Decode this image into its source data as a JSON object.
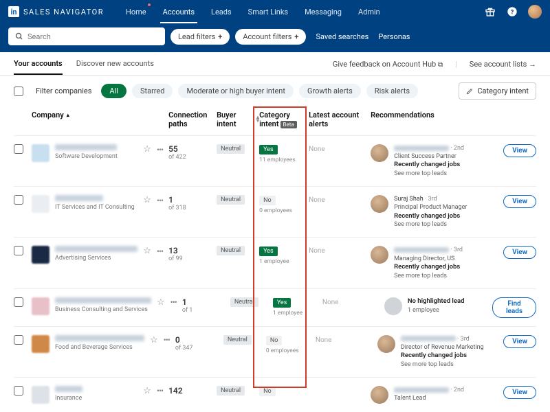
{
  "brand": "SALES NAVIGATOR",
  "nav": {
    "items": [
      "Home",
      "Accounts",
      "Leads",
      "Smart Links",
      "Messaging",
      "Admin"
    ],
    "active_index": 1
  },
  "search": {
    "placeholder": "Search",
    "lead_filters": "Lead filters",
    "account_filters": "Account filters",
    "saved_searches": "Saved searches",
    "personas": "Personas"
  },
  "subtabs": {
    "items": [
      "Your accounts",
      "Discover new accounts"
    ],
    "active_index": 0,
    "feedback": "Give feedback on Account Hub",
    "see_lists": "See account lists"
  },
  "filters": {
    "label": "Filter companies",
    "chips": [
      "All",
      "Starred",
      "Moderate or high buyer intent",
      "Growth alerts",
      "Risk alerts"
    ],
    "active_index": 0,
    "category_intent_btn": "Category intent"
  },
  "columns": {
    "company": "Company",
    "conn": "Connection paths",
    "buyer": "Buyer intent",
    "cat": "Category intent",
    "beta": "Beta",
    "alerts": "Latest account alerts",
    "rec": "Recommendations"
  },
  "labels": {
    "view": "View",
    "find_leads": "Find leads",
    "see_more": "See more top leads",
    "changed_jobs": "Recently changed jobs",
    "no_highlighted": "No highlighted lead",
    "neutral": "Neutral",
    "yes": "Yes",
    "no": "No",
    "none": "None"
  },
  "rows": [
    {
      "industry": "Software Development",
      "conn_n": "55",
      "conn_of": "of 422",
      "buyer": "Neutral",
      "cat": "Yes",
      "cat_emp": "11 employees",
      "alert": "None",
      "rec": {
        "degree": "2nd",
        "title": "Client Success Partner",
        "bold": "Recently changed jobs",
        "link": "See more top leads",
        "btn": "View"
      }
    },
    {
      "industry": "IT Services and IT Consulting",
      "conn_n": "1",
      "conn_of": "of 318",
      "buyer": "Neutral",
      "cat": "No",
      "cat_emp": "0 employees",
      "alert": "None",
      "rec": {
        "name": "Suraj Shah",
        "degree": "3rd",
        "title": "Principal Product Manager",
        "bold": "Recently changed jobs",
        "link": "See more top leads",
        "btn": "View"
      }
    },
    {
      "industry": "Advertising Services",
      "conn_n": "13",
      "conn_of": "of 99",
      "buyer": "Neutral",
      "cat": "Yes",
      "cat_emp": "1 employee",
      "alert": "None",
      "rec": {
        "degree": "3rd",
        "title": "Managing Director, US",
        "bold": "Recently changed jobs",
        "link": "See more top leads",
        "btn": "View"
      }
    },
    {
      "industry": "Business Consulting and Services",
      "conn_n": "1",
      "conn_of": "of 1",
      "buyer": "Neutral",
      "cat": "Yes",
      "cat_emp": "1 employee",
      "alert": "None",
      "rec": {
        "no_highlight": true,
        "sub": "1 employee",
        "btn": "Find leads"
      }
    },
    {
      "industry": "Food and Beverage Services",
      "conn_n": "0",
      "conn_of": "of 347",
      "buyer": "Neutral",
      "cat": "No",
      "cat_emp": "0 employees",
      "alert": "None",
      "rec": {
        "degree": "3rd",
        "title": "Director of Revenue Marketing",
        "bold": "Recently changed jobs",
        "link": "See more top leads",
        "btn": "View"
      }
    },
    {
      "industry": "Insurance",
      "conn_n": "142",
      "conn_of": "",
      "buyer": "Neutral",
      "cat": "No",
      "cat_emp": "",
      "alert": "",
      "rec": {
        "degree": "2nd",
        "title": "Talent Lead",
        "btn": "View"
      }
    }
  ]
}
